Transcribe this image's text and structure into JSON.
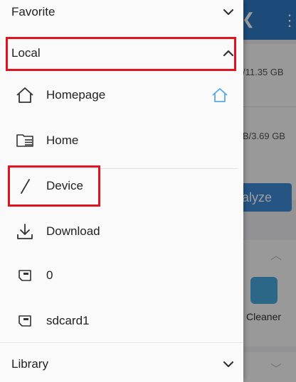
{
  "background": {
    "storage_1": "/11.35 GB",
    "storage_2": "B/3.69 GB",
    "analyze_label": "alyze",
    "cleaner_label": "Cleaner"
  },
  "drawer": {
    "sections": {
      "favorite": {
        "label": "Favorite",
        "icon": "chevron-down-icon"
      },
      "local": {
        "label": "Local",
        "icon": "chevron-up-icon"
      },
      "library": {
        "label": "Library",
        "icon": "chevron-down-icon"
      }
    },
    "local_items": [
      {
        "label": "Homepage",
        "icon": "home-icon",
        "extra_icon": "home-outline-blue-icon"
      },
      {
        "label": "Home",
        "icon": "folder-list-icon"
      },
      {
        "label": "Device",
        "icon": "slash-icon"
      },
      {
        "label": "Download",
        "icon": "download-icon"
      },
      {
        "label": "0",
        "icon": "sd-card-icon"
      },
      {
        "label": "sdcard1",
        "icon": "sd-card-icon"
      }
    ]
  },
  "colors": {
    "accent_blue": "#2f79c3",
    "highlight_red": "#e0141e",
    "home_outline_blue": "#5aa9e6"
  }
}
